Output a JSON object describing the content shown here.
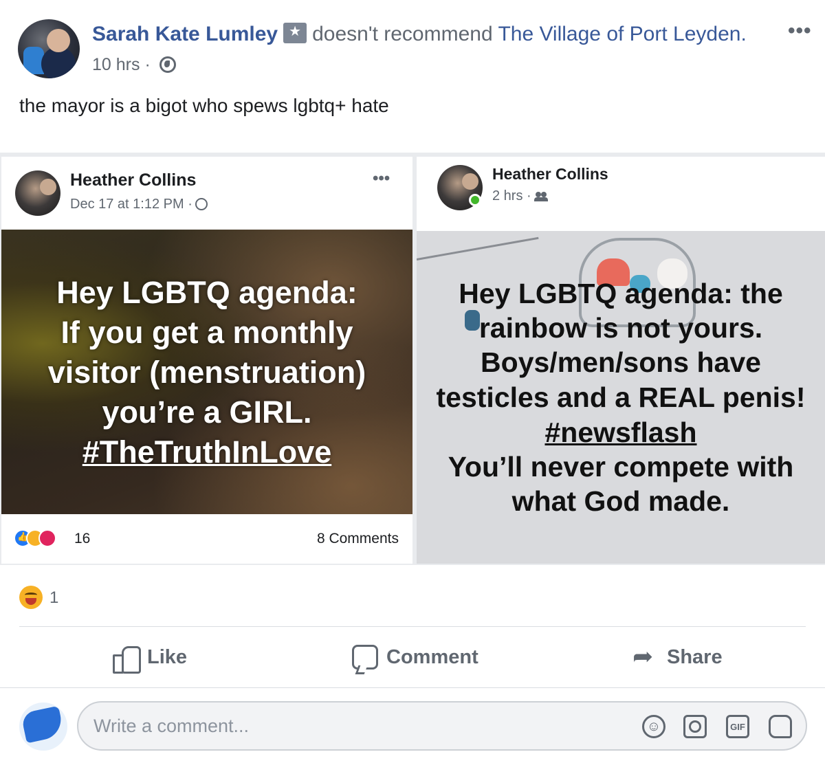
{
  "post": {
    "author": "Sarah Kate Lumley",
    "verb": "doesn't recommend",
    "page": "The Village of Port Leyden.",
    "time": "10 hrs",
    "meta_sep": "·",
    "text": "the mayor is a bigot who spews lgbtq+ hate",
    "more": "•••"
  },
  "shared_left": {
    "name": "Heather Collins",
    "meta": "Dec 17 at 1:12 PM ·",
    "more": "•••",
    "image_lines": [
      "Hey LGBTQ agenda:",
      "If you get a monthly",
      "visitor (menstruation)",
      "you’re a GIRL.",
      "#TheTruthInLove"
    ],
    "reaction_count": "16",
    "comments": "8 Comments"
  },
  "shared_right": {
    "name": "Heather Collins",
    "meta": "2 hrs ·",
    "image_lines": [
      "Hey LGBTQ agenda: the",
      "rainbow is not yours.",
      "Boys/men/sons have",
      "testicles and a REAL penis!",
      "#newsflash",
      "You’ll never compete with",
      "what God made."
    ]
  },
  "summary": {
    "count": "1"
  },
  "actions": {
    "like": "Like",
    "comment": "Comment",
    "share": "Share"
  },
  "composer": {
    "placeholder": "Write a comment...",
    "gif": "GIF",
    "emoji": "☺"
  },
  "colors": {
    "link": "#385898",
    "secondary_text": "#606770",
    "online": "#42b72a"
  },
  "icons": [
    "badge-icon",
    "globe-icon",
    "friends-icon",
    "like-icon",
    "comment-icon",
    "share-icon",
    "emoji-icon",
    "camera-icon",
    "gif-icon",
    "sticker-icon"
  ]
}
